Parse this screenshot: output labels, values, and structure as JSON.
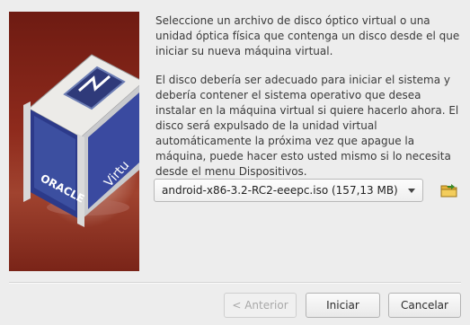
{
  "wizard": {
    "paragraph1": "Seleccione un archivo de disco óptico virtual o una unidad óptica física que contenga un disco desde el que iniciar su nueva máquina virtual.",
    "paragraph2": "El disco debería ser adecuado para iniciar el sistema y debería contener el sistema operativo que desea instalar en la máquina virtual si quiere hacerlo ahora. El disco será expulsado de la unidad virtual automáticamente la próxima vez que apague la máquina, puede hacer esto usted mismo si lo necesita desde el menu Dispositivos.",
    "disk_select": {
      "selected": "android-x86-3.2-RC2-eeepc.iso (157,13 MB)"
    },
    "logo_text": {
      "brand": "ORACLE",
      "product": "Virtu"
    }
  },
  "buttons": {
    "back": "< Anterior",
    "start": "Iniciar",
    "cancel": "Cancelar"
  },
  "colors": {
    "banner_dark": "#6e1b12",
    "folder_icon": "#e6b33a",
    "folder_arrow": "#3a8a2a"
  }
}
